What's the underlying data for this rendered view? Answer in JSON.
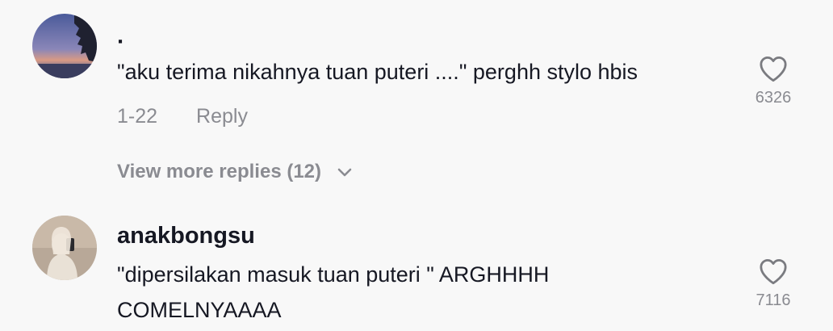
{
  "comments": [
    {
      "username": "·",
      "text": "\"aku terima nikahnya tuan puteri ....\" perghh stylo hbis",
      "date": "1-22",
      "reply_label": "Reply",
      "like_count": "6326",
      "avatar_icon": "sunset-avatar",
      "view_more_label": "View more replies (12)"
    },
    {
      "username": "anakbongsu",
      "text": "\"dipersilakan masuk tuan puteri \" ARGHHHH COMELNYAAAA",
      "like_count": "7116",
      "avatar_icon": "person-avatar"
    }
  ],
  "icons": {
    "like": "heart-icon",
    "expand": "chevron-down-icon"
  },
  "colors": {
    "background": "#f8f8f8",
    "primary_text": "#161823",
    "secondary_text": "#8a8b91"
  }
}
